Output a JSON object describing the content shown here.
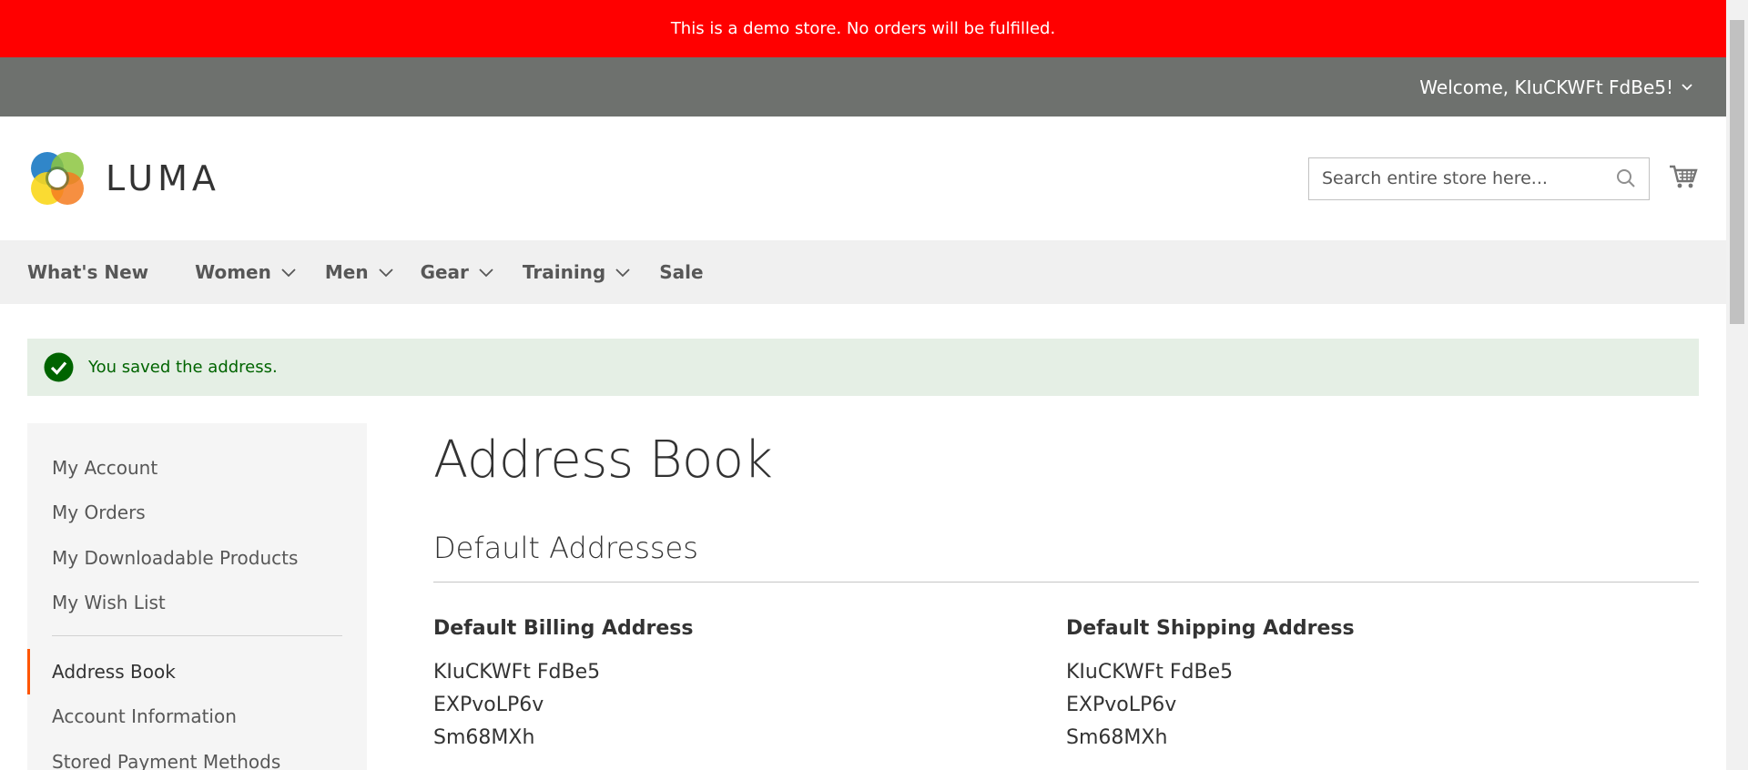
{
  "demo_notice": "This is a demo store. No orders will be fulfilled.",
  "header": {
    "welcome": "Welcome, KIuCKWFt FdBe5!",
    "logo_text": "LUMA",
    "search_placeholder": "Search entire store here..."
  },
  "nav": {
    "items": [
      {
        "label": "What's New",
        "has_dropdown": false
      },
      {
        "label": "Women",
        "has_dropdown": true
      },
      {
        "label": "Men",
        "has_dropdown": true
      },
      {
        "label": "Gear",
        "has_dropdown": true
      },
      {
        "label": "Training",
        "has_dropdown": true
      },
      {
        "label": "Sale",
        "has_dropdown": false
      }
    ]
  },
  "message": "You saved the address.",
  "sidebar": {
    "items": [
      "My Account",
      "My Orders",
      "My Downloadable Products",
      "My Wish List",
      "Address Book",
      "Account Information",
      "Stored Payment Methods"
    ],
    "active": "Address Book"
  },
  "main": {
    "title": "Address Book",
    "section_title": "Default Addresses",
    "billing": {
      "title": "Default Billing Address",
      "lines": [
        "KIuCKWFt FdBe5",
        "EXPvoLP6v",
        "Sm68MXh"
      ]
    },
    "shipping": {
      "title": "Default Shipping Address",
      "lines": [
        "KIuCKWFt FdBe5",
        "EXPvoLP6v",
        "Sm68MXh"
      ]
    }
  },
  "colors": {
    "demo_bar": "#ff0000",
    "panel_header": "#6e716e",
    "nav_bg": "#f0f0f0",
    "success_bg": "#e5efe5",
    "success_text": "#006400",
    "active_accent": "#ff5501"
  }
}
